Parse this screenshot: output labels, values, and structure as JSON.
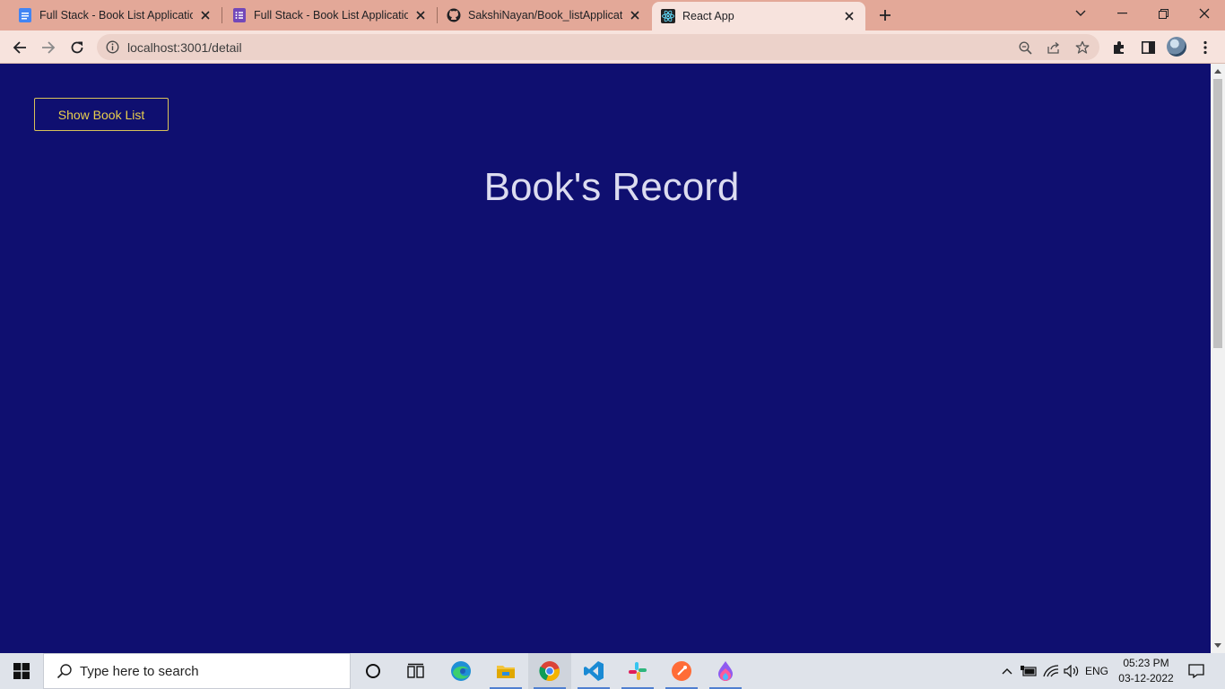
{
  "browser": {
    "tabs": [
      {
        "title": "Full Stack - Book List Application",
        "icon": "google-docs-icon",
        "active": false
      },
      {
        "title": "Full Stack - Book List Application",
        "icon": "google-forms-icon",
        "active": false
      },
      {
        "title": "SakshiNayan/Book_listApplication",
        "icon": "github-icon",
        "active": false
      },
      {
        "title": "React App",
        "icon": "react-icon",
        "active": true
      }
    ],
    "url": "localhost:3001/detail",
    "colors": {
      "tabstrip": "#e3a898",
      "toolbar": "#f7e3dd"
    }
  },
  "page": {
    "show_button_label": "Show Book List",
    "title": "Book's Record",
    "colors": {
      "background": "#0f0f70",
      "button_accent": "#e9cf4d",
      "title": "#dcdcf0"
    }
  },
  "taskbar": {
    "search_placeholder": "Type here to search",
    "apps": [
      "cortana-icon",
      "task-view-icon",
      "edge-icon",
      "file-explorer-icon",
      "chrome-icon",
      "vscode-icon",
      "slack-icon",
      "postman-icon",
      "figma-like-icon"
    ],
    "tray_language": "ENG",
    "time": "05:23 PM",
    "date": "03-12-2022"
  }
}
